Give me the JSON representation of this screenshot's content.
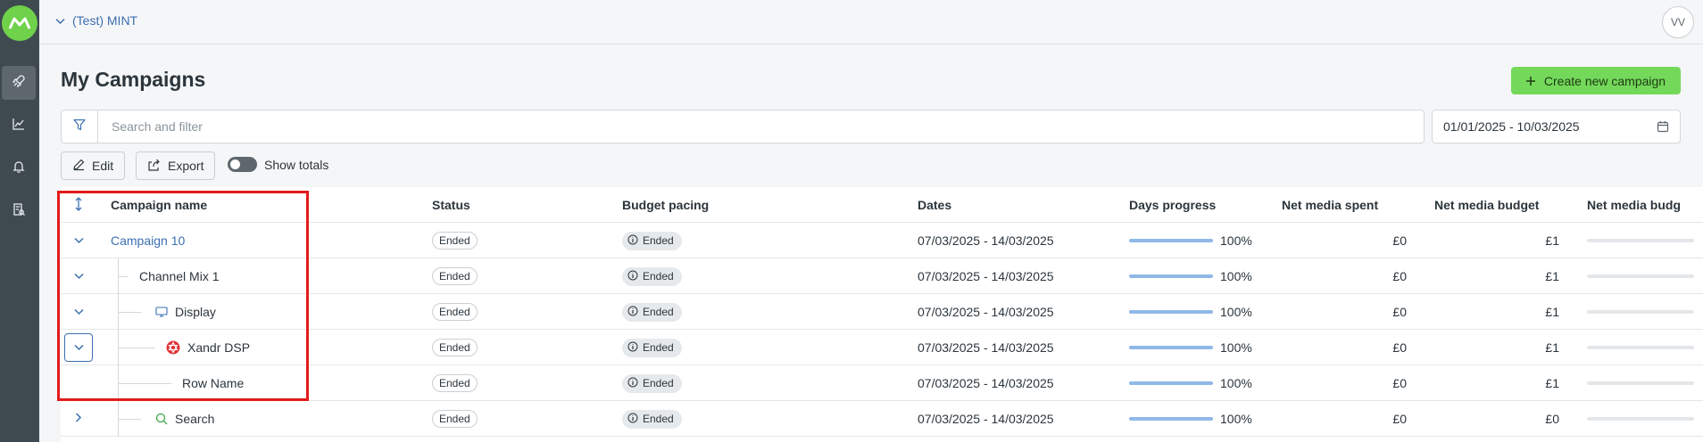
{
  "sidebar": {
    "items": [
      {
        "icon": "rocket-icon",
        "active": true
      },
      {
        "icon": "chart-line-icon",
        "active": false
      },
      {
        "icon": "bell-icon",
        "active": false
      },
      {
        "icon": "report-icon",
        "active": false
      }
    ]
  },
  "topbar": {
    "org_name": "(Test) MINT",
    "avatar_initials": "VV"
  },
  "page": {
    "title": "My Campaigns",
    "create_button": "Create new campaign"
  },
  "search": {
    "placeholder": "Search and filter",
    "date_range": "01/01/2025 - 10/03/2025"
  },
  "toolbar": {
    "edit_label": "Edit",
    "export_label": "Export",
    "show_totals_label": "Show totals"
  },
  "table": {
    "columns": [
      "Campaign name",
      "Status",
      "Budget pacing",
      "Dates",
      "Days progress",
      "Net media spent",
      "Net media budget",
      "Net media budg"
    ],
    "rows": [
      {
        "name": "Campaign 10",
        "status": "Ended",
        "pacing": "Ended",
        "dates": "07/03/2025 - 14/03/2025",
        "progress": "100%",
        "spent": "£0",
        "budget": "£1"
      },
      {
        "name": "Channel Mix 1",
        "status": "Ended",
        "pacing": "Ended",
        "dates": "07/03/2025 - 14/03/2025",
        "progress": "100%",
        "spent": "£0",
        "budget": "£1"
      },
      {
        "name": "Display",
        "status": "Ended",
        "pacing": "Ended",
        "dates": "07/03/2025 - 14/03/2025",
        "progress": "100%",
        "spent": "£0",
        "budget": "£1"
      },
      {
        "name": "Xandr DSP",
        "status": "Ended",
        "pacing": "Ended",
        "dates": "07/03/2025 - 14/03/2025",
        "progress": "100%",
        "spent": "£0",
        "budget": "£1"
      },
      {
        "name": "Row Name",
        "status": "Ended",
        "pacing": "Ended",
        "dates": "07/03/2025 - 14/03/2025",
        "progress": "100%",
        "spent": "£0",
        "budget": "£1"
      },
      {
        "name": "Search",
        "status": "Ended",
        "pacing": "Ended",
        "dates": "07/03/2025 - 14/03/2025",
        "progress": "100%",
        "spent": "£0",
        "budget": "£0"
      }
    ]
  },
  "colors": {
    "accent": "#3b6fb0",
    "create_button": "#74d95a",
    "sidebar": "#3f4a50",
    "highlight": "#e31b1b"
  }
}
